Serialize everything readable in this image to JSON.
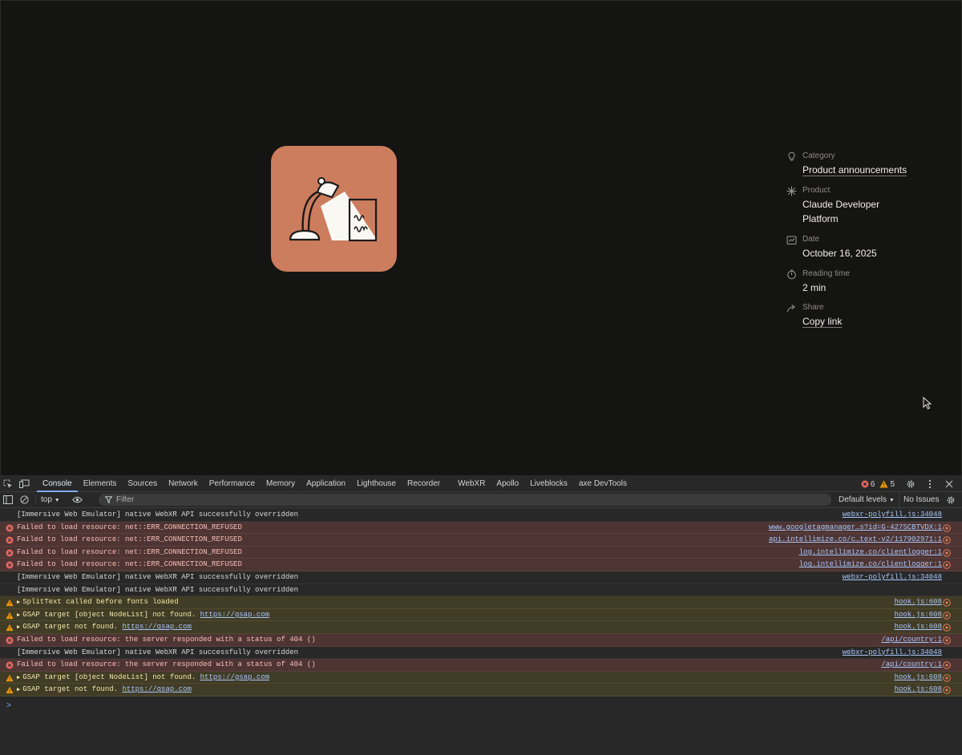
{
  "meta": {
    "category_label": "Category",
    "category_value": "Product announcements",
    "product_label": "Product",
    "product_value_line1": "Claude Developer",
    "product_value_line2": "Platform",
    "date_label": "Date",
    "date_value": "October 16, 2025",
    "reading_label": "Reading time",
    "reading_value": "2 min",
    "share_label": "Share",
    "share_value": "Copy link"
  },
  "colors": {
    "tile": "#cc7d5e",
    "background": "#141413",
    "error": "#e46962",
    "warning": "#f29900"
  },
  "devtools": {
    "tabs": [
      "Console",
      "Elements",
      "Sources",
      "Network",
      "Performance",
      "Memory",
      "Application",
      "Lighthouse",
      "Recorder",
      "WebXR",
      "Apollo",
      "Liveblocks",
      "axe DevTools"
    ],
    "active_tab": "Console",
    "error_count": "6",
    "warning_count": "5",
    "context": "top",
    "filter_placeholder": "Filter",
    "levels": "Default levels",
    "issues": "No Issues",
    "prompt": ">"
  },
  "console_rows": [
    {
      "type": "info",
      "expand": false,
      "text": "[Immersive Web Emulator] native WebXR API successfully overridden",
      "link": "",
      "source": "webxr-polyfill.js:34048"
    },
    {
      "type": "error",
      "expand": false,
      "text": "Failed to load resource: net::ERR_CONNECTION_REFUSED",
      "link": "",
      "source": "www.googletagmanager…s?id=G-427SCBTVDX:1"
    },
    {
      "type": "error",
      "expand": false,
      "text": "Failed to load resource: net::ERR_CONNECTION_REFUSED",
      "link": "",
      "source": "api.intellimize.co/c…text-v2/117902971:1"
    },
    {
      "type": "error",
      "expand": false,
      "text": "Failed to load resource: net::ERR_CONNECTION_REFUSED",
      "link": "",
      "source": "log.intellimize.co/clientlogger:1"
    },
    {
      "type": "error",
      "expand": false,
      "text": "Failed to load resource: net::ERR_CONNECTION_REFUSED",
      "link": "",
      "source": "log.intellimize.co/clientlogger:1"
    },
    {
      "type": "info",
      "expand": false,
      "text": "[Immersive Web Emulator] native WebXR API successfully overridden",
      "link": "",
      "source": "webxr-polyfill.js:34048"
    },
    {
      "type": "info",
      "expand": false,
      "text": "[Immersive Web Emulator] native WebXR API successfully overridden",
      "link": "",
      "source": ""
    },
    {
      "type": "warning",
      "expand": true,
      "text": "SplitText called before fonts loaded",
      "link": "",
      "source": "hook.js:608"
    },
    {
      "type": "warning",
      "expand": true,
      "text": "GSAP target [object NodeList] not found. ",
      "link": "https://gsap.com",
      "source": "hook.js:608"
    },
    {
      "type": "warning",
      "expand": true,
      "text": "GSAP target  not found. ",
      "link": "https://gsap.com",
      "source": "hook.js:608"
    },
    {
      "type": "error",
      "expand": false,
      "text": "Failed to load resource: the server responded with a status of 404 ()",
      "link": "",
      "source": "/api/country:1"
    },
    {
      "type": "info",
      "expand": false,
      "text": "[Immersive Web Emulator] native WebXR API successfully overridden",
      "link": "",
      "source": "webxr-polyfill.js:34048"
    },
    {
      "type": "error",
      "expand": false,
      "text": "Failed to load resource: the server responded with a status of 404 ()",
      "link": "",
      "source": "/api/country:1"
    },
    {
      "type": "warning",
      "expand": true,
      "text": "GSAP target [object NodeList] not found. ",
      "link": "https://gsap.com",
      "source": "hook.js:608"
    },
    {
      "type": "warning",
      "expand": true,
      "text": "GSAP target  not found. ",
      "link": "https://gsap.com",
      "source": "hook.js:608"
    }
  ]
}
